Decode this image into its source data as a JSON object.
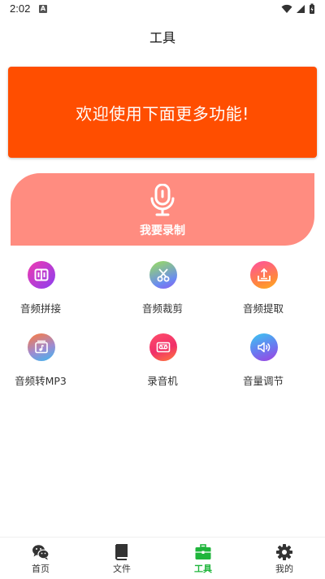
{
  "status_bar": {
    "time": "2:02",
    "notif_letter": "A"
  },
  "header": {
    "title": "工具"
  },
  "banner": {
    "text": "欢迎使用下面更多功能!"
  },
  "record": {
    "label": "我要录制",
    "icon": "microphone-icon"
  },
  "tools": [
    {
      "label": "音频拼接",
      "icon": "audio-merge-icon"
    },
    {
      "label": "音频裁剪",
      "icon": "scissors-icon"
    },
    {
      "label": "音频提取",
      "icon": "upload-icon"
    },
    {
      "label": "音频转MP3",
      "icon": "music-note-icon"
    },
    {
      "label": "录音机",
      "icon": "tape-recorder-icon"
    },
    {
      "label": "音量调节",
      "icon": "speaker-icon"
    }
  ],
  "nav": {
    "items": [
      {
        "label": "首页",
        "icon": "wechat-icon"
      },
      {
        "label": "文件",
        "icon": "book-icon"
      },
      {
        "label": "工具",
        "icon": "toolbox-icon",
        "active": true
      },
      {
        "label": "我的",
        "icon": "gear-icon"
      }
    ]
  },
  "colors": {
    "banner": "#ff4e00",
    "record_card": "#ff8c80",
    "active_nav": "#1fb53b"
  }
}
